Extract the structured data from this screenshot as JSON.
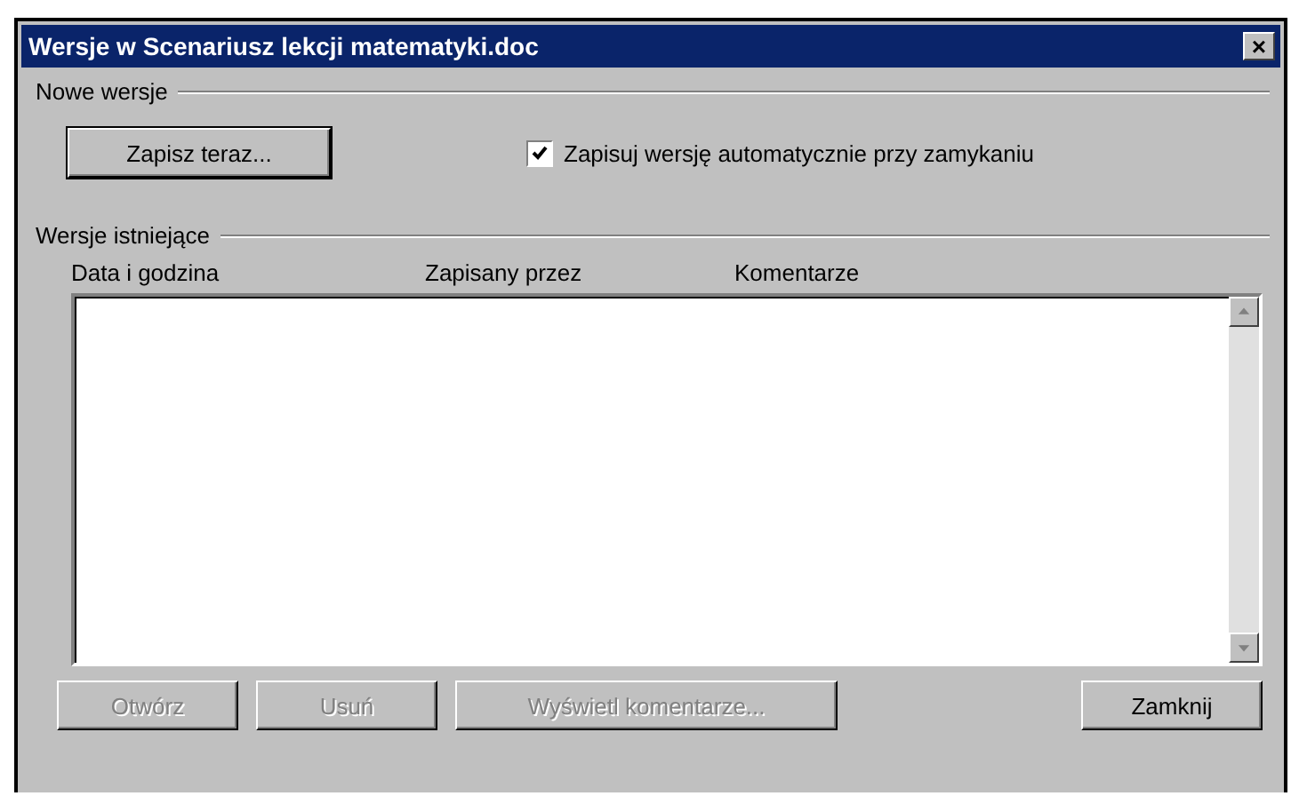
{
  "window": {
    "title": "Wersje w Scenariusz lekcji matematyki.doc",
    "close": "×"
  },
  "new_versions": {
    "heading": "Nowe wersje",
    "save_button": "Zapisz teraz...",
    "auto_save": {
      "label": "Zapisuj wersję automatycznie przy zamykaniu",
      "checked": true
    }
  },
  "existing_versions": {
    "heading": "Wersje istniejące",
    "columns": [
      "Data i godzina",
      "Zapisany przez",
      "Komentarze"
    ]
  },
  "buttons": [
    {
      "label": "Otwórz",
      "disabled": true
    },
    {
      "label": "Usuń",
      "disabled": true
    },
    {
      "label": "Wyświetl komentarze...",
      "disabled": true
    },
    {
      "label": "Zamknij",
      "disabled": false
    }
  ]
}
